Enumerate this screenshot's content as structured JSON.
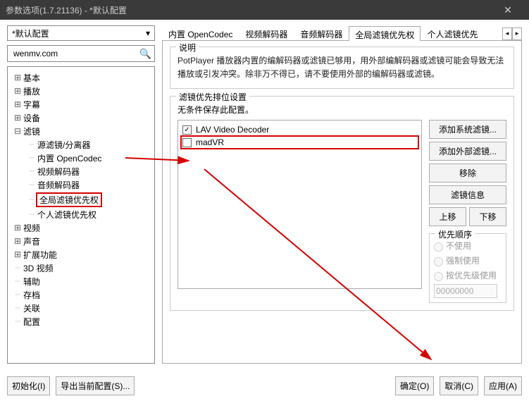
{
  "window": {
    "title": "参数选项(1.7.21136) - *默认配置"
  },
  "profile": {
    "selected": "*默认配置"
  },
  "search": {
    "value": "wenmv.com"
  },
  "tree": [
    {
      "exp": "+",
      "label": "基本",
      "depth": 1
    },
    {
      "exp": "+",
      "label": "播放",
      "depth": 1
    },
    {
      "exp": "+",
      "label": "字幕",
      "depth": 1
    },
    {
      "exp": "+",
      "label": "设备",
      "depth": 1
    },
    {
      "exp": "-",
      "label": "滤镜",
      "depth": 1
    },
    {
      "exp": "",
      "label": "源滤镜/分离器",
      "depth": 2
    },
    {
      "exp": "",
      "label": "内置 OpenCodec",
      "depth": 2
    },
    {
      "exp": "",
      "label": "视频解码器",
      "depth": 2
    },
    {
      "exp": "",
      "label": "音频解码器",
      "depth": 2
    },
    {
      "exp": "",
      "label": "全局滤镜优先权",
      "depth": 2,
      "boxed": true
    },
    {
      "exp": "",
      "label": "个人滤镜优先权",
      "depth": 2
    },
    {
      "exp": "+",
      "label": "视频",
      "depth": 1
    },
    {
      "exp": "+",
      "label": "声音",
      "depth": 1
    },
    {
      "exp": "+",
      "label": "扩展功能",
      "depth": 1
    },
    {
      "exp": "",
      "label": "3D 视频",
      "depth": 1
    },
    {
      "exp": "",
      "label": "辅助",
      "depth": 1
    },
    {
      "exp": "",
      "label": "存档",
      "depth": 1
    },
    {
      "exp": "",
      "label": "关联",
      "depth": 1
    },
    {
      "exp": "",
      "label": "配置",
      "depth": 1
    }
  ],
  "tabs": {
    "items": [
      "内置 OpenCodec",
      "视频解码器",
      "音频解码器",
      "全局滤镜优先权",
      "个人滤镜优先"
    ],
    "active": 3
  },
  "description": {
    "title": "说明",
    "text": "PotPlayer 播放器内置的编解码器或滤镜已够用，用外部编解码器或滤镜可能会导致无法播放或引发冲突。除非万不得已，请不要使用外部的编解码器或滤镜。"
  },
  "filterGroup": {
    "title": "滤镜优先排位设置",
    "subtitle": "无条件保存此配置。",
    "items": [
      {
        "label": "LAV Video Decoder",
        "checked": true
      },
      {
        "label": "madVR",
        "checked": false,
        "boxed": true
      }
    ],
    "buttons": {
      "addSystem": "添加系统滤镜...",
      "addExternal": "添加外部滤镜...",
      "remove": "移除",
      "info": "滤镜信息",
      "up": "上移",
      "down": "下移"
    },
    "priority": {
      "title": "优先顺序",
      "none": "不使用",
      "force": "强制使用",
      "byPriority": "按优先级使用",
      "value": "00000000"
    }
  },
  "footer": {
    "init": "初始化(I)",
    "export": "导出当前配置(S)...",
    "ok": "确定(O)",
    "cancel": "取消(C)",
    "apply": "应用(A)"
  }
}
